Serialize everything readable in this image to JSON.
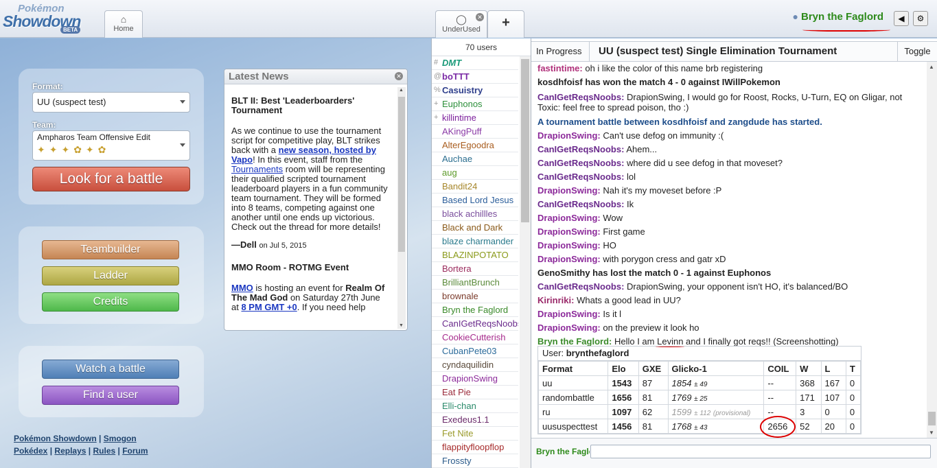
{
  "header": {
    "logo": {
      "line1": "Pokémon",
      "line2": "Showdown",
      "badge": "BETA"
    },
    "tabs": [
      {
        "label": "Home",
        "icon": "home-icon"
      },
      {
        "label": "UnderUsed",
        "icon": "chat-bubble-icon"
      },
      {
        "label": "+",
        "icon": "plus-icon"
      }
    ],
    "username": "Bryn the Faglord",
    "sound_icon": "speaker-icon",
    "settings_icon": "gear-icon"
  },
  "mainmenu": {
    "format_label": "Format:",
    "format_value": "UU (suspect test)",
    "team_label": "Team:",
    "team_value": "Ampharos Team Offensive Edit",
    "look_button": "Look for a battle",
    "teambuilder_button": "Teambuilder",
    "ladder_button": "Ladder",
    "credits_button": "Credits",
    "watch_button": "Watch a battle",
    "find_button": "Find a user",
    "footer": {
      "link1": "Pokémon Showdown",
      "link2": "Smogon",
      "link3": "Pokédex",
      "link4": "Replays",
      "link5": "Rules",
      "link6": "Forum",
      "sep": "|"
    }
  },
  "news": {
    "title": "Latest News",
    "item1_title": "BLT II: Best 'Leaderboarders' Tournament",
    "item1_text_a": "As we continue to use the tournament script for competitive play, BLT strikes back with a ",
    "item1_link1": "new season, hosted by Vapo",
    "item1_text_b": "! In this event, staff from the ",
    "item1_link2": "Tournaments",
    "item1_text_c": " room will be representing their qualified scripted tournament leaderboard players in a fun community team tournament. They will be formed into 8 teams, competing against one another until one ends up victorious. Check out the thread for more details!",
    "item1_author": "—Dell",
    "item1_date": "on Jul 5, 2015",
    "item2_title": "MMO Room - ROTMG Event",
    "item2_link1": "MMO",
    "item2_text_a": " is hosting an event for ",
    "item2_bold": "Realm Of The Mad God",
    "item2_text_b": " on Saturday 27th June at ",
    "item2_link2": "8 PM GMT +0",
    "item2_text_c": ". If you need help"
  },
  "userlist": {
    "count": "70 users",
    "users": [
      {
        "group": "#",
        "name": "DMT",
        "color": "#1a9a7a",
        "style": "bold-italic"
      },
      {
        "group": "@",
        "name": "boTTT",
        "color": "#7a2aa5",
        "style": "bold"
      },
      {
        "group": "%",
        "name": "Casuistry",
        "color": "#2f3f8c",
        "style": "bold"
      },
      {
        "group": "+",
        "name": "Euphonos",
        "color": "#2c8f3a",
        "style": "normal"
      },
      {
        "group": "+",
        "name": "killintime",
        "color": "#7c1f9c",
        "style": "normal"
      },
      {
        "group": "",
        "name": "AKingPuff",
        "color": "#8a3aa6",
        "style": "normal"
      },
      {
        "group": "",
        "name": "AlterEgoodra",
        "color": "#a85c1e",
        "style": "normal"
      },
      {
        "group": "",
        "name": "Auchae",
        "color": "#2a6d8f",
        "style": "normal"
      },
      {
        "group": "",
        "name": "aug",
        "color": "#5c9a2a",
        "style": "normal"
      },
      {
        "group": "",
        "name": "Bandit24",
        "color": "#a6862a",
        "style": "normal"
      },
      {
        "group": "",
        "name": "Based Lord Jesus",
        "color": "#2a5d9a",
        "style": "normal"
      },
      {
        "group": "",
        "name": "black achillles",
        "color": "#7a4d9c",
        "style": "normal"
      },
      {
        "group": "",
        "name": "Black and Dark",
        "color": "#8a5a1a",
        "style": "normal"
      },
      {
        "group": "",
        "name": "blaze charmander",
        "color": "#2a7a8c",
        "style": "normal"
      },
      {
        "group": "",
        "name": "BLAZINPOTATO",
        "color": "#8a9a1a",
        "style": "normal"
      },
      {
        "group": "",
        "name": "Bortera",
        "color": "#9a2a5c",
        "style": "normal"
      },
      {
        "group": "",
        "name": "BrilliantBrunch",
        "color": "#5a8a3a",
        "style": "normal"
      },
      {
        "group": "",
        "name": "brownale",
        "color": "#7a3a2a",
        "style": "normal"
      },
      {
        "group": "",
        "name": "Bryn the Faglord",
        "color": "#3a8a2a",
        "style": "normal"
      },
      {
        "group": "",
        "name": "CanIGetReqsNoobs",
        "color": "#6a2a8c",
        "style": "normal"
      },
      {
        "group": "",
        "name": "CookieCutterish",
        "color": "#a62a8c",
        "style": "normal"
      },
      {
        "group": "",
        "name": "CubanPete03",
        "color": "#2a6a9a",
        "style": "normal"
      },
      {
        "group": "",
        "name": "cyndaquilidin",
        "color": "#5a4a3a",
        "style": "normal"
      },
      {
        "group": "",
        "name": "DrapionSwing",
        "color": "#8c2a9a",
        "style": "normal"
      },
      {
        "group": "",
        "name": "Eat Pie",
        "color": "#9a2a3a",
        "style": "normal"
      },
      {
        "group": "",
        "name": "Elli-chan",
        "color": "#2a8a6a",
        "style": "normal"
      },
      {
        "group": "",
        "name": "Exedeus1.1",
        "color": "#6a2a6a",
        "style": "normal"
      },
      {
        "group": "",
        "name": "Fet Nite",
        "color": "#9a9a2a",
        "style": "normal"
      },
      {
        "group": "",
        "name": "flappityfloopflop",
        "color": "#a62a2a",
        "style": "normal"
      },
      {
        "group": "",
        "name": "Frossty",
        "color": "#2a5a8a",
        "style": "normal"
      }
    ]
  },
  "room": {
    "status": "In Progress",
    "title": "UU (suspect test) Single Elimination Tournament",
    "toggle": "Toggle",
    "messages": [
      {
        "type": "chat",
        "name": "fastintime:",
        "text": "oh i like the color of this name brb registering",
        "color": "#b0307a"
      },
      {
        "type": "sys",
        "text": "kosdhfoisf has won the match 4 - 0 against IWillPokemon"
      },
      {
        "type": "chatwrap",
        "name": "CanIGetReqsNoobs:",
        "text": "DrapionSwing, I would go for Roost, Rocks, U-Turn, EQ on Gligar, not Toxic: feel free to spread poison, tho :)",
        "color": "#6a2a8c"
      },
      {
        "type": "tour",
        "text": "A tournament battle between kosdhfoisf and zangdude has started."
      },
      {
        "type": "chat",
        "name": "DrapionSwing:",
        "text": "Can't use defog on immunity :(",
        "color": "#8c2a9a"
      },
      {
        "type": "chat",
        "name": "CanIGetReqsNoobs:",
        "text": "Ahem...",
        "color": "#6a2a8c"
      },
      {
        "type": "chat",
        "name": "CanIGetReqsNoobs:",
        "text": "where did u see defog in that moveset?",
        "color": "#6a2a8c"
      },
      {
        "type": "chat",
        "name": "CanIGetReqsNoobs:",
        "text": "lol",
        "color": "#6a2a8c"
      },
      {
        "type": "chat",
        "name": "DrapionSwing:",
        "text": "Nah it's my moveset before :P",
        "color": "#8c2a9a"
      },
      {
        "type": "chat",
        "name": "CanIGetReqsNoobs:",
        "text": "Ik",
        "color": "#6a2a8c"
      },
      {
        "type": "chat",
        "name": "DrapionSwing:",
        "text": "Wow",
        "color": "#8c2a9a"
      },
      {
        "type": "chat",
        "name": "DrapionSwing:",
        "text": "First game",
        "color": "#8c2a9a"
      },
      {
        "type": "chat",
        "name": "DrapionSwing:",
        "text": "HO",
        "color": "#8c2a9a"
      },
      {
        "type": "chat",
        "name": "DrapionSwing:",
        "text": "with porygon cress and gatr xD",
        "color": "#8c2a9a"
      },
      {
        "type": "sys",
        "text": "GenoSmithy has lost the match 0 - 1 against Euphonos"
      },
      {
        "type": "chat",
        "name": "CanIGetReqsNoobs:",
        "text": "DrapionSwing, your opponent isn't HO, it's balanced/BO",
        "color": "#6a2a8c"
      },
      {
        "type": "chat",
        "name": "Kirinriki:",
        "text": "Whats a good lead in UU?",
        "color": "#9a2a6a"
      },
      {
        "type": "chat",
        "name": "DrapionSwing:",
        "text": "Is it l",
        "color": "#8c2a9a"
      },
      {
        "type": "chat",
        "name": "DrapionSwing:",
        "text": "on the preview it look ho",
        "color": "#8c2a9a"
      }
    ],
    "last_msg": {
      "name": "Bryn the Faglord:",
      "text_a": "Hello I am ",
      "highlight": "Levinn",
      "text_b": " and I finally got reqs!! (Screenshotting)",
      "color": "#3a8a2a"
    },
    "ladder": {
      "user_label": "User:",
      "user_value": "brynthefaglord",
      "headers": [
        "Format",
        "Elo",
        "GXE",
        "Glicko-1",
        "COIL",
        "W",
        "L",
        "T"
      ],
      "rows": [
        {
          "format": "uu",
          "elo": "1543",
          "gxe": "87",
          "glicko": "1854",
          "dev": "± 49",
          "prov": "",
          "coil": "--",
          "w": "368",
          "l": "167",
          "t": "0"
        },
        {
          "format": "randombattle",
          "elo": "1656",
          "gxe": "81",
          "glicko": "1769",
          "dev": "± 25",
          "prov": "",
          "coil": "--",
          "w": "171",
          "l": "107",
          "t": "0"
        },
        {
          "format": "ru",
          "elo": "1097",
          "gxe": "62",
          "glicko": "1599",
          "dev": "± 112",
          "prov": "(provisional)",
          "coil": "--",
          "w": "3",
          "l": "0",
          "t": "0"
        },
        {
          "format": "uususpecttest",
          "elo": "1456",
          "gxe": "81",
          "glicko": "1768",
          "dev": "± 43",
          "prov": "",
          "coil": "2656",
          "w": "52",
          "l": "20",
          "t": "0"
        }
      ]
    },
    "chatbox_name": "Bryn the Faglord"
  }
}
